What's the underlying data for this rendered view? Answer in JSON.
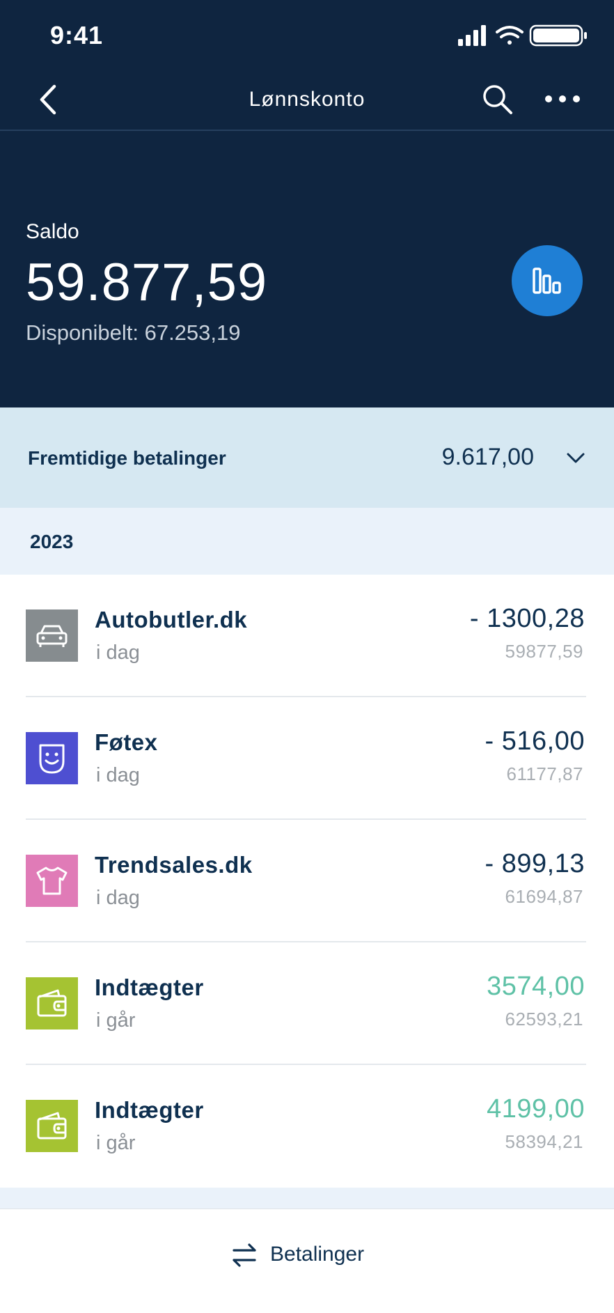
{
  "status_bar": {
    "time": "9:41"
  },
  "nav": {
    "title": "Lønnskonto"
  },
  "account": {
    "balance_label": "Saldo",
    "balance": "59.877,59",
    "available": "Disponibelt: 67.253,19"
  },
  "future_payments": {
    "label": "Fremtidige betalinger",
    "value": "9.617,00"
  },
  "year": "2023",
  "transactions": [
    {
      "name": "Autobutler.dk",
      "when": "i dag",
      "amount": "- 1300,28",
      "balance": "59877,59",
      "icon": "car-icon",
      "icon_color": "#868c8f",
      "positive": false
    },
    {
      "name": "Føtex",
      "when": "i dag",
      "amount": "- 516,00",
      "balance": "61177,87",
      "icon": "smiley-bag-icon",
      "icon_color": "#4e4fd1",
      "positive": false
    },
    {
      "name": "Trendsales.dk",
      "when": "i dag",
      "amount": "- 899,13",
      "balance": "61694,87",
      "icon": "tshirt-icon",
      "icon_color": "#e07bb7",
      "positive": false
    },
    {
      "name": "Indtægter",
      "when": "i går",
      "amount": "3574,00",
      "balance": "62593,21",
      "icon": "wallet-icon",
      "icon_color": "#a5c332",
      "positive": true
    },
    {
      "name": "Indtægter",
      "when": "i går",
      "amount": "4199,00",
      "balance": "58394,21",
      "icon": "wallet-icon",
      "icon_color": "#a5c332",
      "positive": true
    }
  ],
  "tabbar": {
    "payments_label": "Betalinger"
  },
  "colors": {
    "header_bg": "#0f2540",
    "accent": "#1f7fd5",
    "future_bg": "#d6e8f2",
    "positive": "#5ec1a6",
    "text_dark": "#0f3050"
  }
}
